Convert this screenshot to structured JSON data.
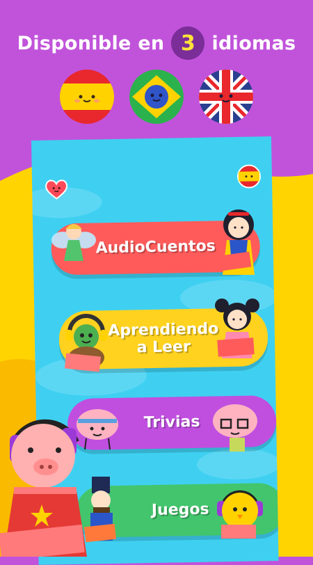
{
  "header": {
    "prefix": "Disponible en",
    "count": "3",
    "suffix": "idiomas"
  },
  "flags": [
    {
      "name": "spain-flag-icon"
    },
    {
      "name": "brazil-flag-icon"
    },
    {
      "name": "uk-flag-icon"
    }
  ],
  "menu": {
    "audio_cuentos": "AudioCuentos",
    "aprendiendo_line1": "Aprendiendo",
    "aprendiendo_line2": "a Leer",
    "trivias": "Trivias",
    "juegos": "Juegos"
  },
  "colors": {
    "purple": "#c153db",
    "yellow": "#ffd400",
    "sky": "#3fd0f1",
    "red_pill": "#ff5b5b",
    "yellow_pill": "#ffd21f",
    "purple_pill": "#c04fe0",
    "green_pill": "#43c56d"
  }
}
